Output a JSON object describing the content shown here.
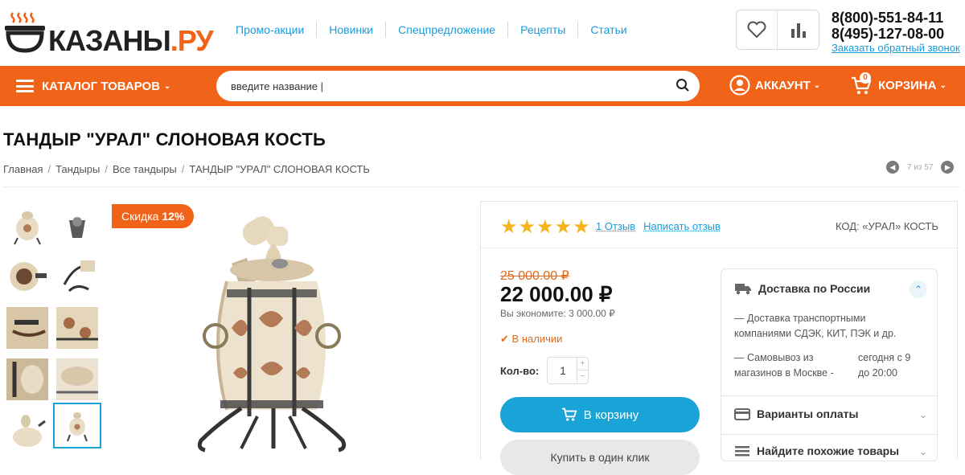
{
  "logo": {
    "text_main": "КАЗАНЫ",
    "text_suffix": ".РУ"
  },
  "topnav": [
    "Промо-акции",
    "Новинки",
    "Спецпредложение",
    "Рецепты",
    "Статьи"
  ],
  "contacts": {
    "phone1": "8(800)-551-84-11",
    "phone2": "8(495)-127-08-00",
    "callback": "Заказать обратный звонок"
  },
  "orangebar": {
    "catalog_label": "КАТАЛОГ ТОВАРОВ",
    "search_value": "введите название |",
    "account_label": "АККАУНТ",
    "cart_label": "КОРЗИНА",
    "cart_count": "0"
  },
  "product": {
    "title": "ТАНДЫР \"УРАЛ\" СЛОНОВАЯ КОСТЬ",
    "breadcrumbs": [
      "Главная",
      "Тандыры",
      "Все тандыры",
      "ТАНДЫР \"УРАЛ\" СЛОНОВАЯ КОСТЬ"
    ],
    "pager": "7 из 57",
    "discount_label": "Скидка",
    "discount_value": "12%",
    "rating": 5,
    "reviews_count": "1 Отзыв",
    "write_review": "Написать отзыв",
    "code": "КОД: «УРАЛ» КОСТЬ",
    "old_price": "25 000.00 ₽",
    "price": "22 000.00 ₽",
    "savings": "Вы экономите: 3 000.00 ₽",
    "stock": "В наличии",
    "qty_label": "Кол-во:",
    "qty": "1",
    "add_to_cart": "В корзину",
    "one_click": "Купить в один клик"
  },
  "delivery": {
    "title": "Доставка по России",
    "line1a": "— Доставка транспортными",
    "line1b": "компаниями СДЭК, КИТ, ПЭК и др.",
    "line2a": "— Самовывоз из",
    "line2b": "магазинов в Москве -",
    "line2c": "сегодня с 9",
    "line2d": "до 20:00",
    "payment_title": "Варианты оплаты",
    "similar_title": "Найдите похожие товары"
  },
  "colors": {
    "accent": "#f06318",
    "link": "#1a9bd7",
    "star": "#f5b21a",
    "button": "#1aa3d6"
  }
}
